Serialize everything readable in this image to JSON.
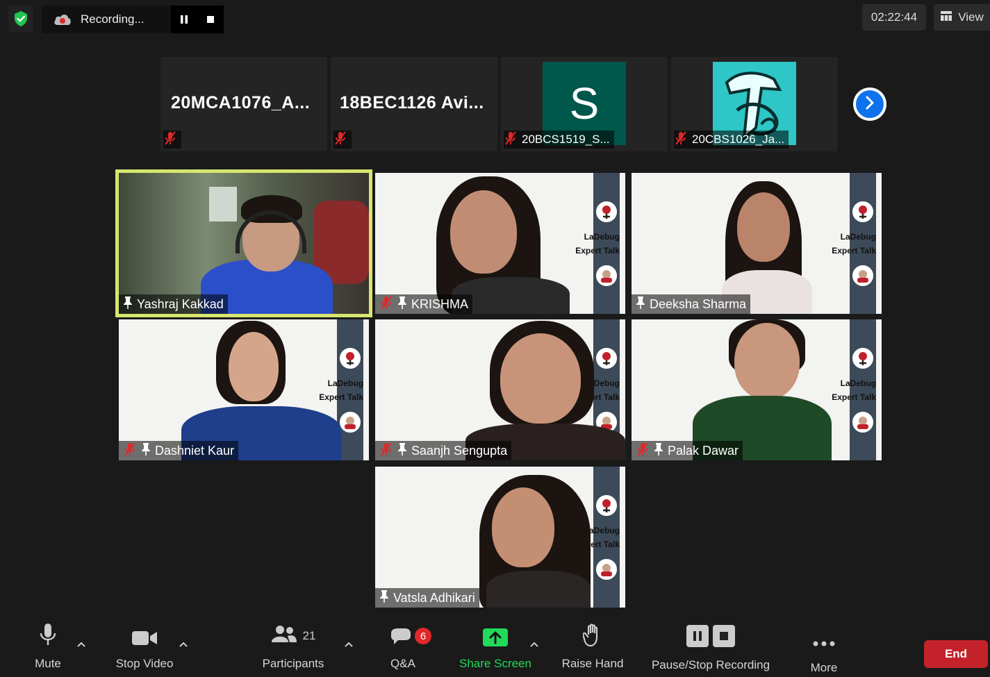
{
  "recording": {
    "status_label": "Recording..."
  },
  "meeting": {
    "elapsed_time": "02:22:44"
  },
  "view_button": {
    "label": "View"
  },
  "strip_participants": [
    {
      "label": "20MCA1076_A...",
      "kind": "name-only",
      "muted": true
    },
    {
      "label": "18BEC1126  Avi...",
      "kind": "name-only",
      "muted": true
    },
    {
      "label": "20BCS1519_S...",
      "kind": "avatar-letter",
      "avatar_letter": "S",
      "avatar_color": "#00574b",
      "muted": true
    },
    {
      "label": "20CBS1026_Ja...",
      "kind": "avatar-image",
      "avatar_color": "#2ec6c6",
      "muted": true
    }
  ],
  "grid_participants": [
    {
      "name": "Yashraj Kakkad",
      "muted": false,
      "active_speaker": true
    },
    {
      "name": "KRISHMA",
      "muted": true,
      "active_speaker": false
    },
    {
      "name": "Deeksha Sharma",
      "muted": false,
      "active_speaker": false
    },
    {
      "name": "Dashniet Kaur",
      "muted": true,
      "active_speaker": false
    },
    {
      "name": "Saanjh Sengupta",
      "muted": true,
      "active_speaker": false
    },
    {
      "name": "Palak Dawar",
      "muted": true,
      "active_speaker": false
    },
    {
      "name": "Vatsla Adhikari",
      "muted": false,
      "active_speaker": false
    }
  ],
  "background_overlay": {
    "line1": "LaDebug",
    "line2": "Expert Talk"
  },
  "toolbar": {
    "mute_label": "Mute",
    "video_label": "Stop Video",
    "participants_label": "Participants",
    "participants_count": "21",
    "qa_label": "Q&A",
    "qa_badge": "6",
    "share_label": "Share Screen",
    "raise_hand_label": "Raise Hand",
    "recording_label": "Pause/Stop Recording",
    "more_label": "More",
    "end_label": "End"
  },
  "colors": {
    "accent_share": "#23d959",
    "active_speaker_border": "#d6e66e",
    "end_button": "#c4222a",
    "muted_icon": "#e02828",
    "next_button": "#0e72ed"
  }
}
